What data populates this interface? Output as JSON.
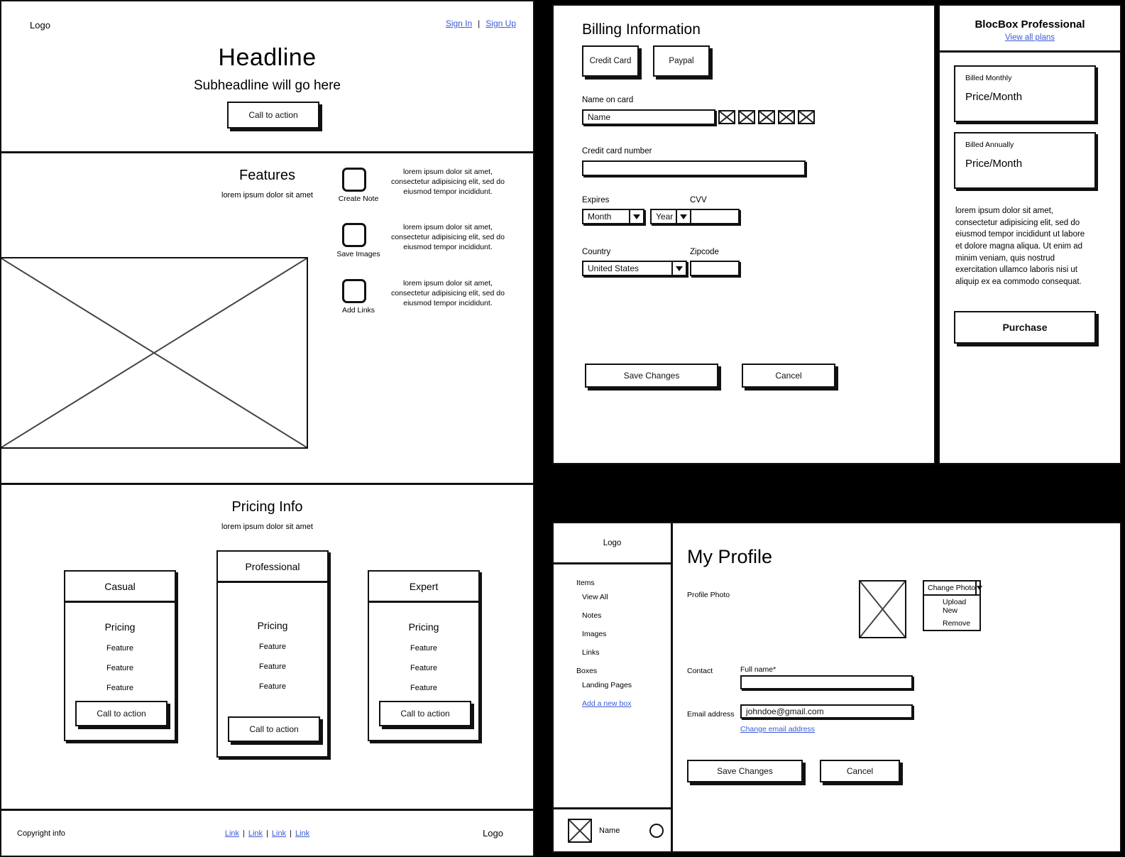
{
  "landing": {
    "logo": "Logo",
    "sign_in": "Sign In",
    "sign_up": "Sign Up",
    "separator": "|",
    "headline": "Headline",
    "subheadline": "Subheadline will go here",
    "cta": "Call to action",
    "features": {
      "title": "Features",
      "subtitle": "lorem ipsum dolor sit amet",
      "items": [
        {
          "label": "Create Note",
          "text": "lorem ipsum dolor sit amet, consectetur adipisicing elit, sed do eiusmod tempor incididunt."
        },
        {
          "label": "Save Images",
          "text": "lorem ipsum dolor sit amet, consectetur adipisicing elit, sed do eiusmod tempor incididunt."
        },
        {
          "label": "Add Links",
          "text": "lorem ipsum dolor sit amet, consectetur adipisicing elit, sed do eiusmod tempor incididunt."
        }
      ]
    },
    "pricing": {
      "title": "Pricing Info",
      "subtitle": "lorem ipsum dolor sit amet",
      "plans": [
        {
          "name": "Casual",
          "price": "Pricing",
          "features": [
            "Feature",
            "Feature",
            "Feature"
          ],
          "cta": "Call to action"
        },
        {
          "name": "Professional",
          "price": "Pricing",
          "features": [
            "Feature",
            "Feature",
            "Feature"
          ],
          "cta": "Call to action"
        },
        {
          "name": "Expert",
          "price": "Pricing",
          "features": [
            "Feature",
            "Feature",
            "Feature"
          ],
          "cta": "Call to action"
        }
      ]
    },
    "footer": {
      "copyright": "Copyright info",
      "links": [
        "Link",
        "Link",
        "Link",
        "Link"
      ],
      "logo": "Logo"
    }
  },
  "billing": {
    "title": "Billing Information",
    "methods": [
      "Credit Card",
      "Paypal"
    ],
    "name_on_card_label": "Name on card",
    "name_on_card_value": "Name",
    "card_icon_count": 5,
    "card_number_label": "Credit card number",
    "card_number_value": "",
    "expires_label": "Expires",
    "expires_month": "Month",
    "expires_year": "Year",
    "cvv_label": "CVV",
    "cvv_value": "",
    "country_label": "Country",
    "country_value": "United States",
    "zipcode_label": "Zipcode",
    "zipcode_value": "",
    "save_label": "Save Changes",
    "cancel_label": "Cancel"
  },
  "plan_panel": {
    "title": "BlocBox Professional",
    "view_all": "View all plans",
    "options": [
      {
        "term": "Billed Monthly",
        "price": "Price/Month"
      },
      {
        "term": "Billed Annually",
        "price": "Price/Month"
      }
    ],
    "description": "lorem ipsum dolor sit amet, consectetur adipisicing elit, sed do eiusmod tempor incididunt ut labore et dolore magna aliqua. Ut enim ad minim veniam, quis nostrud exercitation ullamco laboris nisi ut aliquip ex ea commodo consequat.",
    "purchase_label": "Purchase"
  },
  "profile_app": {
    "logo": "Logo",
    "nav": [
      {
        "type": "group",
        "label": "Items"
      },
      {
        "type": "item",
        "label": "View All"
      },
      {
        "type": "item",
        "label": "Notes"
      },
      {
        "type": "item",
        "label": "Images"
      },
      {
        "type": "item",
        "label": "Links"
      },
      {
        "type": "group",
        "label": "Boxes"
      },
      {
        "type": "item",
        "label": "Landing Pages"
      }
    ],
    "add_box": "Add a new box",
    "user_name": "Name",
    "title": "My Profile",
    "photo_label": "Profile Photo",
    "photo_dropdown": {
      "value": "Change Photo",
      "options": [
        "Upload New",
        "Remove"
      ]
    },
    "contact_label": "Contact",
    "fullname_label": "Full name*",
    "fullname_value": "",
    "email_label": "Email address",
    "email_value": "johndoe@gmail.com",
    "change_email": "Change email address",
    "save_label": "Save Changes",
    "cancel_label": "Cancel"
  }
}
